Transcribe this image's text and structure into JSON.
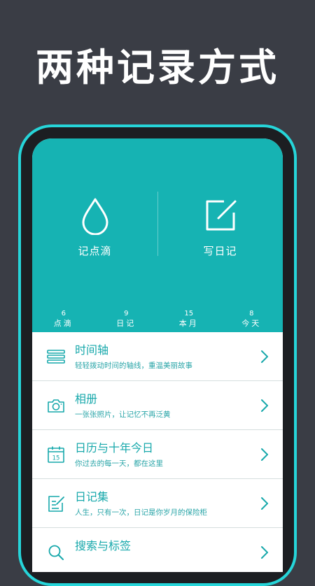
{
  "headline": "两种记录方式",
  "hero": {
    "drop_label": "记点滴",
    "write_label": "写日记"
  },
  "stats": [
    {
      "value": "6",
      "label": "点滴"
    },
    {
      "value": "9",
      "label": "日记"
    },
    {
      "value": "15",
      "label": "本月"
    },
    {
      "value": "8",
      "label": "今天"
    }
  ],
  "menu": [
    {
      "title": "时间轴",
      "subtitle": "轻轻拨动时间的轴线，重温美丽故事",
      "icon": "timeline-icon"
    },
    {
      "title": "相册",
      "subtitle": "一张张照片，让记忆不再泛黄",
      "icon": "camera-icon"
    },
    {
      "title": "日历与十年今日",
      "subtitle": "你过去的每一天，都在这里",
      "icon": "calendar-icon",
      "calendar_day": "15"
    },
    {
      "title": "日记集",
      "subtitle": "人生，只有一次，日记是你岁月的保险柜",
      "icon": "diary-icon"
    },
    {
      "title": "搜索与标签",
      "subtitle": "",
      "icon": "search-icon"
    }
  ],
  "colors": {
    "background": "#3a3d45",
    "accent": "#16b3b3",
    "frame": "#26d5d9",
    "text_accent": "#17a8ab"
  }
}
